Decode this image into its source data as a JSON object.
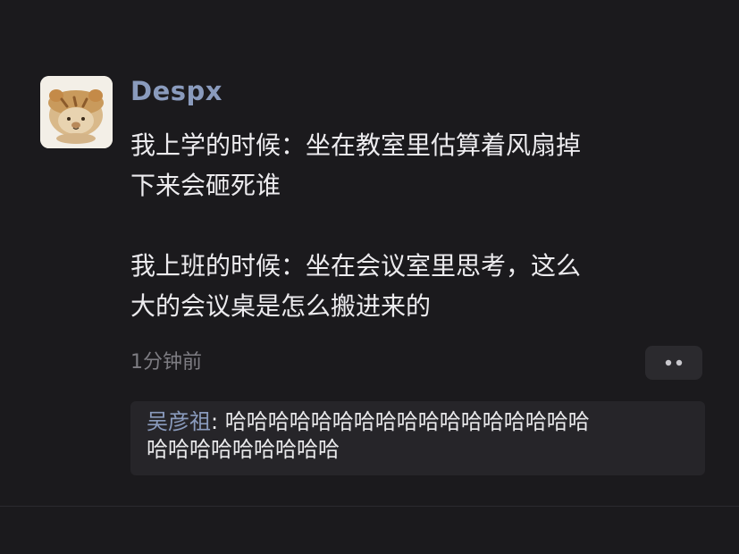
{
  "post": {
    "username": "Despx",
    "content_paragraphs": [
      "我上学的时候：坐在教室里估算着风扇掉\n下来会砸死谁",
      "我上班的时候：坐在会议室里思考，这么\n大的会议桌是怎么搬进来的"
    ],
    "timestamp": "1分钟前",
    "more_icon": "more-dots-icon"
  },
  "comments": [
    {
      "author": "吴彦祖",
      "separator": ": ",
      "text": "哈哈哈哈哈哈哈哈哈哈哈哈哈哈哈哈哈哈哈哈哈哈哈哈哈哈哈哈哈哈哈哈哈哈哈哈哈哈哈哈",
      "first_line_text": "哈哈哈哈哈哈哈哈哈哈哈哈哈哈哈哈哈",
      "second_line_text": "哈哈哈哈哈哈哈哈哈"
    }
  ],
  "colors": {
    "background": "#1b1a1d",
    "username": "#8a9bbd",
    "text": "#ecebee",
    "muted": "#7d7c82",
    "panel": "#262529"
  }
}
